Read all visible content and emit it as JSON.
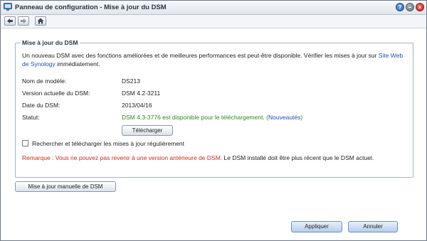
{
  "window": {
    "title": "Panneau de configuration - Mise à jour du DSM",
    "app_icon": "control-panel-icon",
    "controls": {
      "help_label": "?",
      "minimize_label": "–",
      "close_label": "×"
    }
  },
  "toolbar": {
    "icons": [
      "arrow-left-icon",
      "arrow-right-icon",
      "home-icon"
    ]
  },
  "section": {
    "legend": "Mise à jour du DSM",
    "description_part1": "Un nouveau DSM avec des fonctions améliorées et de meilleures performances est peut-être disponible. Vérifier les mises à jour sur ",
    "description_link": "Site Web de Synology",
    "description_part2": " immédiatement.",
    "fields": [
      {
        "label": "Nom de modèle:",
        "value": "DS213"
      },
      {
        "label": "Version actuelle du DSM:",
        "value": "DSM 4.2-3211"
      },
      {
        "label": "Date du DSM:",
        "value": "2013/04/16"
      }
    ],
    "status_label": "Statut:",
    "status_text": "DSM 4.3-3776 est disponible pour le téléchargement. (",
    "status_link": "Nouveautés",
    "status_close": ")",
    "download_button": "Télécharger",
    "auto_update_label": "Rechercher et télécharger les mises à jour régulièrement",
    "auto_update_checked": false,
    "note_red": "Remarque : Vous ne pouvez pas revenir à une version antérieure de DSM.",
    "note_black": " Le DSM installé doit être plus récent que le DSM actuel."
  },
  "manual_update_button": "Mise à jour manuelle de DSM",
  "footer": {
    "apply_button": "Appliquer",
    "cancel_button": "Annuler"
  },
  "colors": {
    "status_green": "#2c8a1b",
    "link_blue": "#1f4fb0",
    "warning_red": "#d0271f"
  }
}
